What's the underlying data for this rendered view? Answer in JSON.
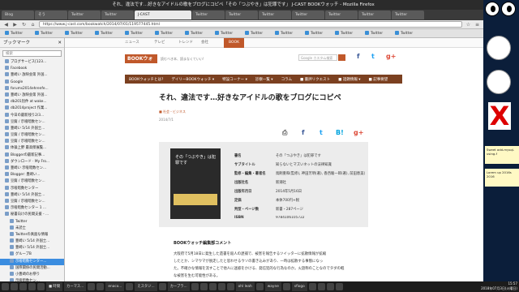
{
  "window_title": "それ、違法です…好きなアイドルの歌をブログにコピペ「その「つぶやき」は犯罪です」 J-CAST BOOKウォッチ - Mozilla Firefox",
  "tabs": [
    "Blog",
    "そう",
    "Twitter",
    "Twitter",
    "J-CAST",
    "Twitter",
    "Twitter",
    "Twitter",
    "Twitter",
    "Twitter",
    "Twitter",
    "Twitter"
  ],
  "url": "https://www.j-cast.com/bookwatch/2014/07/01/119577445.html",
  "bookmarks": [
    "Twitter",
    "Twitter",
    "Twitter",
    "Twitter",
    "Twitter",
    "Twitter",
    "Twitter",
    "Twitter",
    "Twitter",
    "Twitter",
    "Twitter",
    "Twitter",
    "Twitter",
    "Twitter"
  ],
  "sidebar": {
    "title": "ブックマーク",
    "search_placeholder": "検索",
    "items": [
      "ブログサービス[123...",
      "Facebook",
      "豊崎い 放映会第 外国...",
      "Google",
      "forums2014ehrenfe...",
      "豊崎い 放映会第 外国...",
      "db201別件 at wake...",
      "db2014project 作業...",
      "今日の最新残り2/3...",
      "豆腐 / 示唆暗数セン...",
      "豊崎い 5/14 外国士...",
      "豆腐 / 示唆暗数セン...",
      "豆腐 / 示唆暗数セン...",
      "体操上野 最高傑展覧...",
      "Bloggerの最新記事...",
      "ダウンロード · My Fro...",
      "豊崎い 示唆暗数セン...",
      "Blogger: 豊崎い...",
      "豆腐 / 示唆暗数セン...",
      "示唆暗数センター",
      "豊崎い 5/14 外国士...",
      "豆腐 / 示唆暗数セン...",
      "示唆暗数センター 1 ...",
      "秘書向けの民間支援 - ...",
      "Twitter",
      "未読士",
      "Twitterの真面な情報",
      "豊崎い 5/14 外国士...",
      "豊崎い 5/14 外国士...",
      "グループB",
      "示唆暗数センター...",
      "国際関係の民間活動...",
      "小豊崎のお祭り",
      "示唆暗数セン...",
      "グループB",
      "坂本正男(lheko...",
      "東京作者 Vol Gen..."
    ]
  },
  "site": {
    "top_nav": [
      "ニュース",
      "テレビ",
      "トレンド",
      "会社",
      "BOOK"
    ],
    "logo": "BOOKウォッチ",
    "tagline": "読むべき本、読まなくていい!",
    "search_placeholder": "Google カスタム検索",
    "categories": [
      "BOOKウォッチとは?",
      "デイリーBOOKウォッチ ▾",
      "特設コーナー ▾",
      "診察一覧 ▾",
      "コラム",
      "■ 書評リクエスト",
      "■ 話題情報 ▾",
      "■ 記事要望"
    ]
  },
  "article": {
    "title": "それ、違法です…好きなアイドルの歌をブログにコピペ",
    "breadcrumb": "■ 社会・ビジネス",
    "date": "2014/7/1",
    "share_labels": [
      "print",
      "f",
      "t",
      "B!",
      "g+"
    ],
    "book": {
      "cover_title": "その「つぶやき」は犯罪です",
      "cover_band": "ネットでやりがちな違反行為",
      "rows": [
        [
          "書名",
          "その「つぶやき」は犯罪です"
        ],
        [
          "サブタイトル",
          "知らないとマズいネットの法律知識"
        ],
        [
          "監修・編集・著者名",
          "鳥飼重和(監修), 神田芳明(著), 香西駿一郎(著), 前田恵美(著), 深澤諭史(著)"
        ],
        [
          "出版社名",
          "新潮社"
        ],
        [
          "出版年月日",
          "2014年5月16日"
        ],
        [
          "定価",
          "本体700円+税"
        ],
        [
          "判型・ページ数",
          "新書・287ページ"
        ],
        [
          "ISBN",
          "9784106105722"
        ]
      ]
    },
    "section_title": "BOOKウォッチ編集部コメント",
    "body": [
      "大阪府で5月18日に発生した遺書を殺人の逮捕で、被害を報告するツイッターに拡散情報が拡縮",
      "したとか、シマウマが脱走したと思わせるウソの書き込みがあり、一時は拡散する事態になっ",
      "た。不確かな情報を流すことで他人に迷惑をかける、発信犯的な行為なのか。火遊称のことなのでタダの軽",
      "な被害を生む可能性がある。"
    ]
  },
  "desktop_notes": [
    "Sweet add-mysql-using-f",
    "Lorem up 2016s 2016"
  ],
  "taskbar": {
    "items": [
      "",
      "",
      "",
      "",
      "",
      "■ 時間",
      "カーマス...",
      "",
      "",
      "enaco...",
      "",
      "えスタジ...",
      "",
      "カーブラ...",
      "",
      "",
      "",
      "",
      "",
      "ohl leah",
      "",
      "wayne",
      "",
      "sfiogo",
      "",
      "",
      "",
      ""
    ],
    "time": "15:57",
    "date": "2018年07月3日(火曜日)"
  }
}
